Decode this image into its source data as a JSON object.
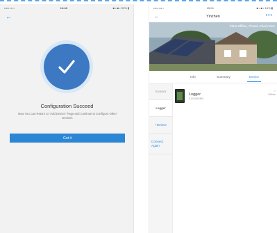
{
  "left": {
    "status": {
      "carrier": "••••• ••• •",
      "time": "14:48",
      "battery": "■ • ■ • 53% ▮"
    },
    "title": "Configuration Succeed",
    "desc": "Now You Can Return to \"Add Device\" Page and Continue to Configure Other Devices",
    "button": "Got it"
  },
  "right": {
    "status": {
      "carrier": "••••• ••• •",
      "time": "15:04",
      "battery": "■ • ■ • 16% ▮"
    },
    "header": {
      "title": "Yinzhen",
      "more": "•••"
    },
    "banner": "Plant Offline, Please Check Dev",
    "tabs": [
      "Info",
      "Summary",
      "Device"
    ],
    "side": [
      "Inverter",
      "Logger",
      "+Device",
      "Connect Again"
    ],
    "devices": [
      {
        "name": "Logger",
        "sn": "S1234567890",
        "status": "Offline"
      }
    ]
  },
  "colors": {
    "accent": "#2d86d4",
    "success": "#3d78c2"
  }
}
